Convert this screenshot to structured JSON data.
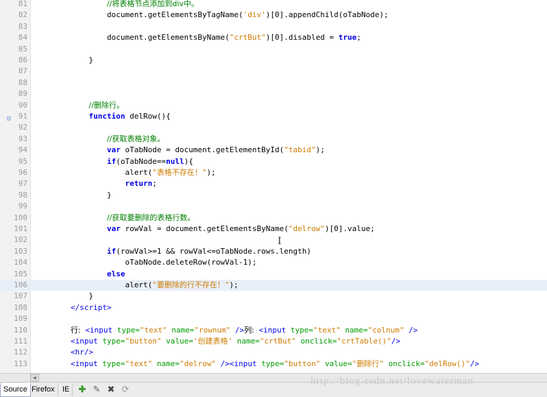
{
  "editor": {
    "lines": [
      {
        "n": "81",
        "html": "                <span class=\"cm cm-zh\">//将表格节点添加到div中。</span>"
      },
      {
        "n": "82",
        "html": "                document.getElementsByTagName(<span class=\"str\">'div'</span>)[0].appendChild(oTabNode);"
      },
      {
        "n": "83",
        "html": ""
      },
      {
        "n": "84",
        "html": "                document.getElementsByName(<span class=\"str\">\"crtBut\"</span>)[0].disabled = <span class=\"kw\">true</span>;"
      },
      {
        "n": "85",
        "html": ""
      },
      {
        "n": "86",
        "html": "            }"
      },
      {
        "n": "87",
        "html": ""
      },
      {
        "n": "88",
        "html": ""
      },
      {
        "n": "89",
        "html": ""
      },
      {
        "n": "90",
        "html": "            <span class=\"cm cm-zh\">//删除行。</span>"
      },
      {
        "n": "91",
        "html": "            <span class=\"kw\">function</span> delRow(){"
      },
      {
        "n": "92",
        "html": ""
      },
      {
        "n": "93",
        "html": "                <span class=\"cm cm-zh\">//获取表格对象。</span>"
      },
      {
        "n": "94",
        "html": "                <span class=\"kw\">var</span> oTabNode = document.getElementById(<span class=\"str\">\"tabid\"</span>);"
      },
      {
        "n": "95",
        "html": "                <span class=\"kw\">if</span>(oTabNode==<span class=\"kw\">null</span>){"
      },
      {
        "n": "96",
        "html": "                    alert(<span class=\"str\">\"<span class=\"zh\">表格不存在！</span>\"</span>);"
      },
      {
        "n": "97",
        "html": "                    <span class=\"kw\">return</span>;"
      },
      {
        "n": "98",
        "html": "                }"
      },
      {
        "n": "99",
        "html": ""
      },
      {
        "n": "100",
        "html": "                <span class=\"cm cm-zh\">//获取要删除的表格行数。</span>"
      },
      {
        "n": "101",
        "html": "                <span class=\"kw\">var</span> rowVal = document.getElementsByName(<span class=\"str\">\"delrow\"</span>)[0].value;"
      },
      {
        "n": "102",
        "html": ""
      },
      {
        "n": "103",
        "html": "                <span class=\"kw\">if</span>(rowVal>=1 && rowVal<=oTabNode.rows.length)"
      },
      {
        "n": "104",
        "html": "                    oTabNode.deleteRow(rowVal-1);"
      },
      {
        "n": "105",
        "html": "                <span class=\"kw\">else</span>"
      },
      {
        "n": "106",
        "html": "                    alert(<span class=\"str\">\"<span class=\"zh\">要删除的行不存在！</span>\"</span>);",
        "current": true
      },
      {
        "n": "107",
        "html": "            }"
      },
      {
        "n": "108",
        "html": "        <span class=\"tag\">&lt;/script&gt;</span>"
      },
      {
        "n": "109",
        "html": ""
      },
      {
        "n": "110",
        "html": "        <span class=\"zh\">行:</span> <span class=\"tag\">&lt;input</span> <span class=\"attr\">type=</span><span class=\"aval\">\"text\"</span> <span class=\"attr\">name=</span><span class=\"aval\">\"rownum\"</span> <span class=\"tag\">/&gt;</span><span class=\"zh\">列:</span> <span class=\"tag\">&lt;input</span> <span class=\"attr\">type=</span><span class=\"aval\">\"text\"</span> <span class=\"attr\">name=</span><span class=\"aval\">\"colnum\"</span> <span class=\"tag\">/&gt;</span>"
      },
      {
        "n": "111",
        "html": "        <span class=\"tag\">&lt;input</span> <span class=\"attr\">type=</span><span class=\"aval\">\"button\"</span> <span class=\"attr\">value=</span><span class=\"aval\">'<span class=\"zh\">创建表格</span>'</span> <span class=\"attr\">name=</span><span class=\"aval\">\"crtBut\"</span> <span class=\"attr\">onclick=</span><span class=\"aval\">\"crtTable()\"</span><span class=\"tag\">/&gt;</span>"
      },
      {
        "n": "112",
        "html": "        <span class=\"tag\">&lt;hr/&gt;</span>"
      },
      {
        "n": "113",
        "html": "        <span class=\"tag\">&lt;input</span> <span class=\"attr\">type=</span><span class=\"aval\">\"text\"</span> <span class=\"attr\">name=</span><span class=\"aval\">\"delrow\"</span> <span class=\"tag\">/&gt;&lt;input</span> <span class=\"attr\">type=</span><span class=\"aval\">\"button\"</span> <span class=\"attr\">value=</span><span class=\"aval\">\"<span class=\"zh\">删除行</span>\"</span> <span class=\"attr\">onclick=</span><span class=\"aval\">\"delRow()\"</span><span class=\"tag\">/&gt;</span>"
      }
    ]
  },
  "bottombar": {
    "tabs": [
      "Source",
      "Firefox",
      "IE"
    ],
    "tools": [
      "add-icon",
      "edit-icon",
      "delete-icon",
      "refresh-icon"
    ]
  },
  "watermark": "http://blog.csdn.net/lovewaterman"
}
